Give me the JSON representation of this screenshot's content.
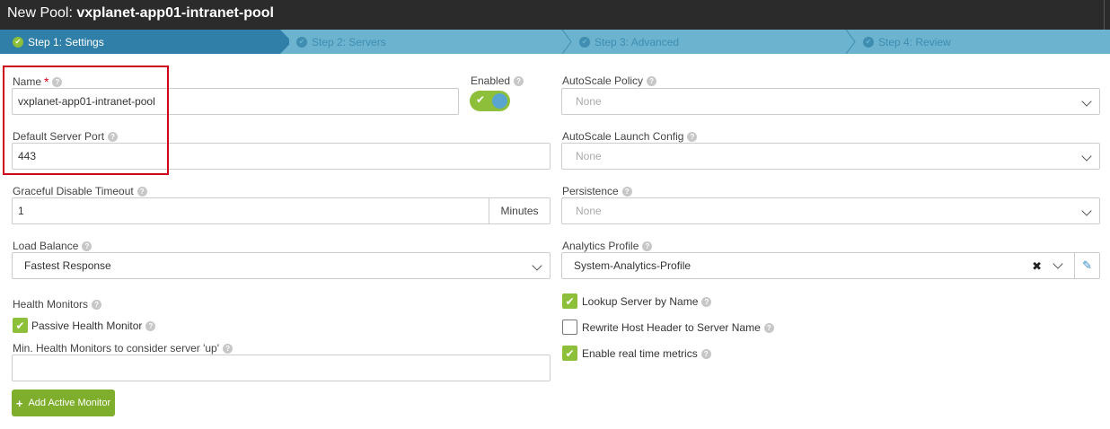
{
  "window": {
    "title_prefix": "New Pool:",
    "title_name": "vxplanet-app01-intranet-pool"
  },
  "steps": [
    {
      "label": "Step 1: Settings",
      "active": true
    },
    {
      "label": "Step 2: Servers",
      "active": false
    },
    {
      "label": "Step 3: Advanced",
      "active": false
    },
    {
      "label": "Step 4: Review",
      "active": false
    }
  ],
  "left": {
    "name": {
      "label": "Name",
      "required": "*",
      "value": "vxplanet-app01-intranet-pool"
    },
    "enabled": {
      "label": "Enabled",
      "checked": true
    },
    "default_port": {
      "label": "Default Server Port",
      "value": "443"
    },
    "graceful": {
      "label": "Graceful Disable Timeout",
      "value": "1",
      "unit": "Minutes"
    },
    "load_balance": {
      "label": "Load Balance",
      "value": "Fastest Response"
    },
    "health_monitors": {
      "label": "Health Monitors"
    },
    "passive": {
      "label": "Passive Health Monitor",
      "checked": true
    },
    "min_health": {
      "label": "Min. Health Monitors to consider server 'up'",
      "value": ""
    },
    "add_monitor": {
      "label": "Add Active Monitor"
    }
  },
  "right": {
    "autoscale_policy": {
      "label": "AutoScale Policy",
      "value": "None"
    },
    "autoscale_launch": {
      "label": "AutoScale Launch Config",
      "value": "None"
    },
    "persistence": {
      "label": "Persistence",
      "value": "None"
    },
    "analytics": {
      "label": "Analytics Profile",
      "value": "System-Analytics-Profile"
    },
    "lookup": {
      "label": "Lookup Server by Name",
      "checked": true
    },
    "rewrite": {
      "label": "Rewrite Host Header to Server Name",
      "checked": false
    },
    "realtime": {
      "label": "Enable real time metrics",
      "checked": true
    }
  },
  "colors": {
    "accent_green": "#8dbf3a",
    "step_active": "#2f7fa8",
    "step_bar": "#6bb3cf",
    "highlight_red": "#d0021b"
  }
}
